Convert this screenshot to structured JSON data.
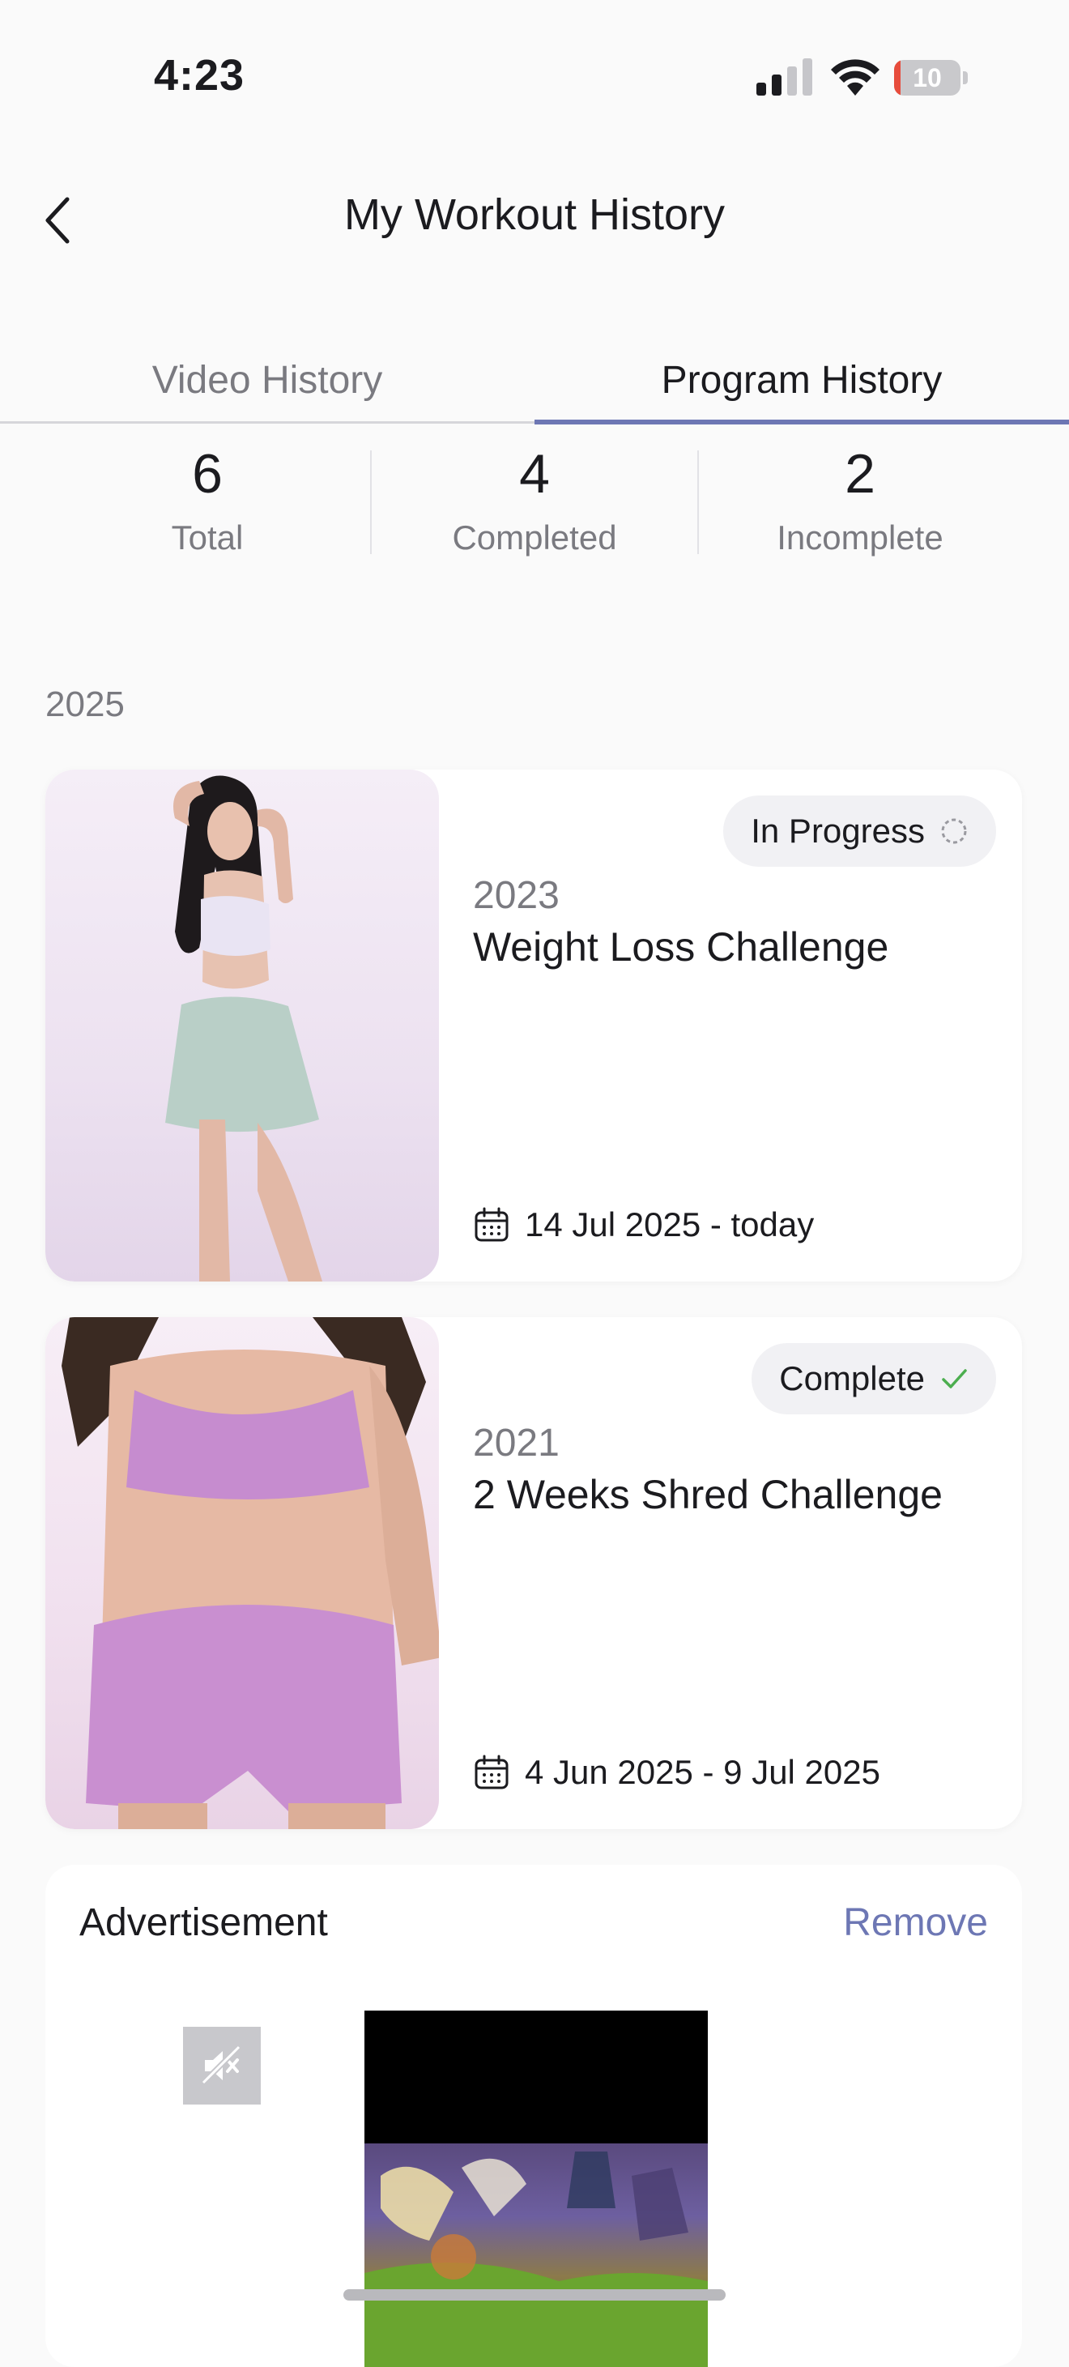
{
  "status_bar": {
    "time": "4:23",
    "battery_level": "10",
    "battery_fraction": 0.1
  },
  "header": {
    "title": "My Workout History"
  },
  "tabs": [
    {
      "label": "Video History",
      "active": false
    },
    {
      "label": "Program History",
      "active": true
    }
  ],
  "stats": [
    {
      "value": "6",
      "label": "Total"
    },
    {
      "value": "4",
      "label": "Completed"
    },
    {
      "value": "2",
      "label": "Incomplete"
    }
  ],
  "year_label": "2025",
  "programs": [
    {
      "status": "In Progress",
      "year": "2023",
      "title": "Weight Loss Challenge",
      "date_range": "14 Jul 2025 - today"
    },
    {
      "status": "Complete",
      "year": "2021",
      "title": "2 Weeks Shred Challenge",
      "date_range": "4 Jun 2025 - 9 Jul 2025"
    }
  ],
  "ad": {
    "label": "Advertisement",
    "remove_label": "Remove"
  },
  "colors": {
    "accent": "#6d77b4",
    "complete_check": "#4cae4f",
    "battery_low": "#e74c3c"
  }
}
